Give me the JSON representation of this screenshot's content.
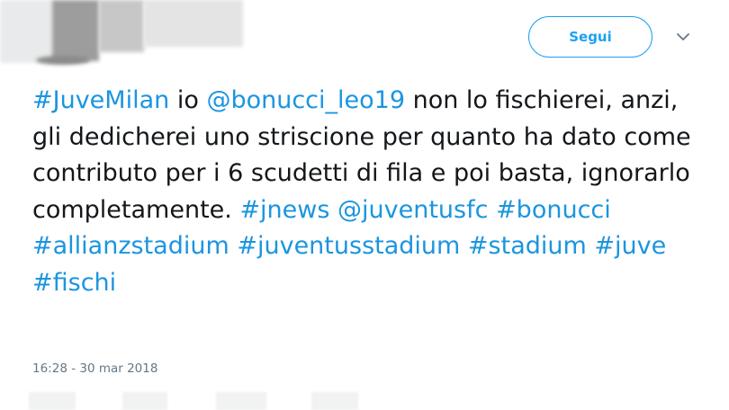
{
  "header": {
    "follow_label": "Segui"
  },
  "icons": {
    "caret": "chevron-down-icon"
  },
  "tweet": {
    "segments": [
      {
        "text": "#JuveMilan",
        "type": "hashtag"
      },
      {
        "text": " io ",
        "type": "text"
      },
      {
        "text": "@bonucci_leo19",
        "type": "mention"
      },
      {
        "text": " non lo fischierei, anzi, gli dedicherei uno striscione per quanto ha dato come contributo per i 6 scudetti di fila e poi basta, ignorarlo completamente. ",
        "type": "text"
      },
      {
        "text": "#jnews",
        "type": "hashtag"
      },
      {
        "text": " ",
        "type": "text"
      },
      {
        "text": "@juventusfc",
        "type": "mention"
      },
      {
        "text": " ",
        "type": "text"
      },
      {
        "text": "#bonucci",
        "type": "hashtag"
      },
      {
        "text": " ",
        "type": "text"
      },
      {
        "text": "#allianzstadium",
        "type": "hashtag"
      },
      {
        "text": " ",
        "type": "text"
      },
      {
        "text": "#juventusstadium",
        "type": "hashtag"
      },
      {
        "text": " ",
        "type": "text"
      },
      {
        "text": "#stadium",
        "type": "hashtag"
      },
      {
        "text": " ",
        "type": "text"
      },
      {
        "text": "#juve",
        "type": "hashtag"
      },
      {
        "text": " ",
        "type": "text"
      },
      {
        "text": "#fischi",
        "type": "hashtag"
      }
    ],
    "timestamp": "16:28 - 30 mar 2018"
  },
  "colors": {
    "link": "#1b95e0",
    "button": "#1da1f2",
    "text": "#14171a",
    "meta": "#657786"
  }
}
